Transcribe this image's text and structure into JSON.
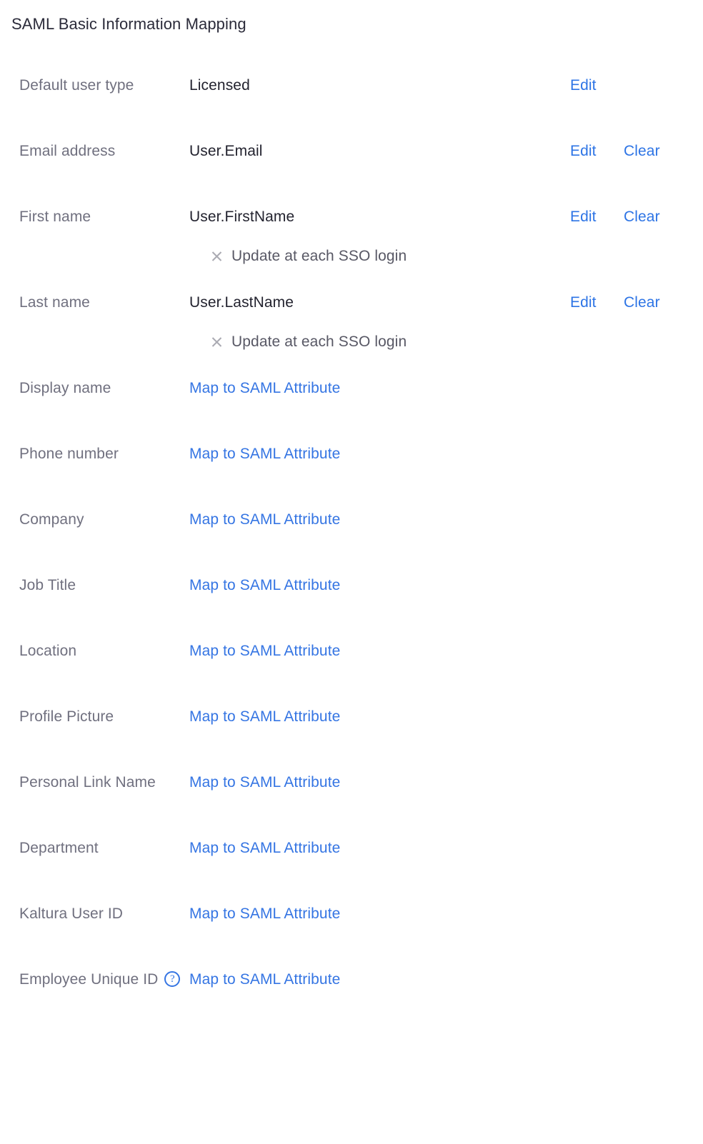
{
  "page": {
    "title": "SAML Basic Information Mapping",
    "background_color": "#ffffff",
    "label_color": "#70707f",
    "value_color": "#23232f",
    "link_color": "#3575e3",
    "action_link_color": "#2d74e5"
  },
  "actions": {
    "edit_label": "Edit",
    "clear_label": "Clear",
    "map_label": "Map to SAML Attribute"
  },
  "sso": {
    "update_label": "Update at each SSO login",
    "icon": "close-x-icon"
  },
  "help": {
    "icon": "question-mark-circle-icon",
    "glyph": "?"
  },
  "rows": [
    {
      "label": "Default user type",
      "value": "Licensed",
      "kind": "value",
      "has_edit": true,
      "has_clear": false,
      "has_sso": false
    },
    {
      "label": "Email address",
      "value": "User.Email",
      "kind": "value",
      "has_edit": true,
      "has_clear": true,
      "has_sso": false
    },
    {
      "label": "First name",
      "value": "User.FirstName",
      "kind": "value",
      "has_edit": true,
      "has_clear": true,
      "has_sso": true
    },
    {
      "label": "Last name",
      "value": "User.LastName",
      "kind": "value",
      "has_edit": true,
      "has_clear": true,
      "has_sso": true
    },
    {
      "label": "Display name",
      "value": "Map to SAML Attribute",
      "kind": "map",
      "has_edit": false,
      "has_clear": false,
      "has_sso": false
    },
    {
      "label": "Phone number",
      "value": "Map to SAML Attribute",
      "kind": "map",
      "has_edit": false,
      "has_clear": false,
      "has_sso": false
    },
    {
      "label": "Company",
      "value": "Map to SAML Attribute",
      "kind": "map",
      "has_edit": false,
      "has_clear": false,
      "has_sso": false
    },
    {
      "label": "Job Title",
      "value": "Map to SAML Attribute",
      "kind": "map",
      "has_edit": false,
      "has_clear": false,
      "has_sso": false
    },
    {
      "label": "Location",
      "value": "Map to SAML Attribute",
      "kind": "map",
      "has_edit": false,
      "has_clear": false,
      "has_sso": false
    },
    {
      "label": "Profile Picture",
      "value": "Map to SAML Attribute",
      "kind": "map",
      "has_edit": false,
      "has_clear": false,
      "has_sso": false
    },
    {
      "label": "Personal Link Name",
      "value": "Map to SAML Attribute",
      "kind": "map",
      "has_edit": false,
      "has_clear": false,
      "has_sso": false
    },
    {
      "label": "Department",
      "value": "Map to SAML Attribute",
      "kind": "map",
      "has_edit": false,
      "has_clear": false,
      "has_sso": false
    },
    {
      "label": "Kaltura User ID",
      "value": "Map to SAML Attribute",
      "kind": "map",
      "has_edit": false,
      "has_clear": false,
      "has_sso": false
    },
    {
      "label": "Employee Unique ID",
      "value": "Map to SAML Attribute",
      "kind": "map",
      "has_edit": false,
      "has_clear": false,
      "has_sso": false,
      "has_help": true
    }
  ]
}
